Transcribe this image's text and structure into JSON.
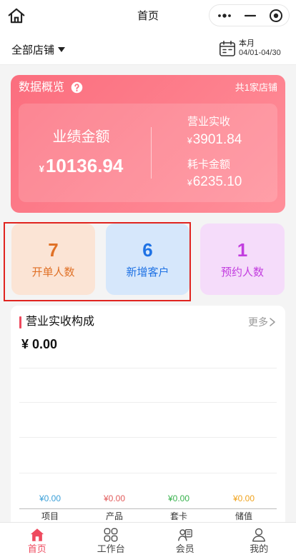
{
  "header": {
    "title": "首页"
  },
  "store_bar": {
    "store_label": "全部店铺",
    "period_label": "本月",
    "date_range": "04/01-04/30"
  },
  "overview": {
    "title": "数据概览",
    "store_count": "共1家店铺",
    "performance": {
      "label": "业绩金额",
      "currency": "¥",
      "value": "10136.94"
    },
    "revenue": {
      "label": "营业实收",
      "currency": "¥",
      "value": "3901.84"
    },
    "card_consumption": {
      "label": "耗卡金额",
      "currency": "¥",
      "value": "6235.10"
    }
  },
  "stats": [
    {
      "value": "7",
      "label": "开单人数",
      "bg": "#fbe4d5",
      "color": "#e07127"
    },
    {
      "value": "6",
      "label": "新增客户",
      "bg": "#d6e7fb",
      "color": "#1f72e4"
    },
    {
      "value": "1",
      "label": "预约人数",
      "bg": "#f5dcfa",
      "color": "#c23ddf"
    }
  ],
  "composition": {
    "title": "营业实收构成",
    "more_label": "更多",
    "total": "¥ 0.00",
    "items": [
      {
        "value": "¥0.00",
        "category": "项目",
        "color": "#3a9fd8"
      },
      {
        "value": "¥0.00",
        "category": "产品",
        "color": "#e25b5b"
      },
      {
        "value": "¥0.00",
        "category": "套卡",
        "color": "#36b14b"
      },
      {
        "value": "¥0.00",
        "category": "储值",
        "color": "#f0a21c"
      }
    ]
  },
  "tabbar": {
    "items": [
      {
        "label": "首页",
        "icon": "home-icon",
        "active": true
      },
      {
        "label": "工作台",
        "icon": "workbench-icon",
        "active": false
      },
      {
        "label": "会员",
        "icon": "member-icon",
        "active": false
      },
      {
        "label": "我的",
        "icon": "profile-icon",
        "active": false
      }
    ]
  },
  "colors": {
    "accent": "#ee4a5e",
    "overview_start": "#fb6e7e",
    "overview_end": "#ff8f9a",
    "inactive_tab": "#444444",
    "highlight_border": "#e0241f"
  }
}
